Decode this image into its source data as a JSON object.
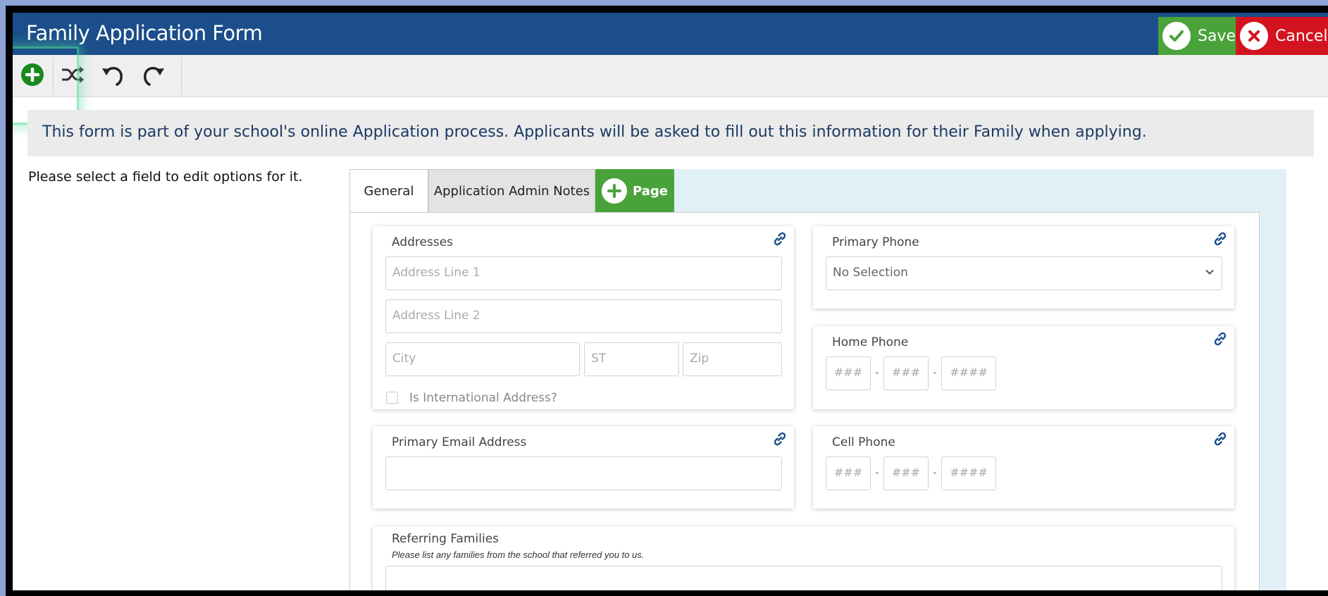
{
  "header": {
    "title": "Family Application Form",
    "save_label": "Save",
    "cancel_label": "Cancel"
  },
  "toolbar": {
    "tools": [
      "add-icon",
      "shuffle-icon",
      "undo-icon",
      "redo-icon"
    ]
  },
  "banner": {
    "text": "This form is part of your school's online Application process. Applicants will be asked to fill out this information for their Family when applying."
  },
  "hint": "Please select a field to edit options for it.",
  "tabs": [
    {
      "label": "General",
      "active": true
    },
    {
      "label": "Application Admin Notes",
      "active": false
    }
  ],
  "page_button_label": "Page",
  "addresses": {
    "label": "Addresses",
    "line1_placeholder": "Address Line 1",
    "line2_placeholder": "Address Line 2",
    "city_placeholder": "City",
    "state_placeholder": "ST",
    "zip_placeholder": "Zip",
    "international_label": "Is International Address?"
  },
  "primary_phone": {
    "label": "Primary Phone",
    "selected": "No Selection"
  },
  "home_phone": {
    "label": "Home Phone",
    "area": "###",
    "prefix": "###",
    "line": "####"
  },
  "email": {
    "label": "Primary Email Address",
    "value": ""
  },
  "cell_phone": {
    "label": "Cell Phone",
    "area": "###",
    "prefix": "###",
    "line": "####"
  },
  "referring": {
    "label": "Referring Families",
    "sublabel": "Please list any families from the school that referred you to us."
  },
  "colors": {
    "header_bg": "#1b4e8a",
    "save_bg": "#4aa33a",
    "cancel_bg": "#d3131f",
    "link_icon": "#1b4e8a"
  }
}
